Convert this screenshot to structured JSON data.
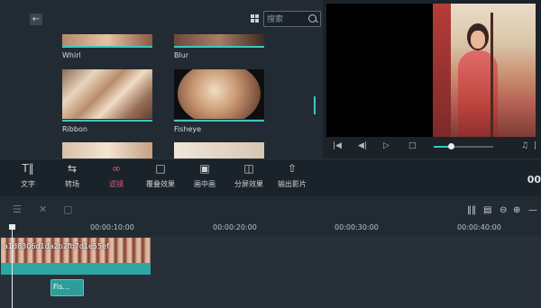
{
  "search": {
    "placeholder": "搜索"
  },
  "effects": {
    "items": [
      {
        "label": "Whirl"
      },
      {
        "label": "Blur"
      },
      {
        "label": "Ribbon"
      },
      {
        "label": "Fisheye"
      }
    ]
  },
  "toolbar": {
    "items": [
      {
        "label": "文字",
        "icon": "text-icon"
      },
      {
        "label": "转场",
        "icon": "transition-icon"
      },
      {
        "label": "滤镜",
        "icon": "filter-icon",
        "active": true
      },
      {
        "label": "覆叠效果",
        "icon": "overlay-icon"
      },
      {
        "label": "画中画",
        "icon": "pip-icon"
      },
      {
        "label": "分屏效果",
        "icon": "split-screen-icon"
      },
      {
        "label": "输出影片",
        "icon": "export-icon"
      }
    ],
    "timecode": "00"
  },
  "ruler": {
    "ticks": [
      "00:00:10:00",
      "00:00:20:00",
      "00:00:30:00",
      "00:00:40:00"
    ]
  },
  "clips": {
    "video_name": "a1d8306d1da2b2fb7d1e55ef",
    "title_clip": "Fis..."
  },
  "colors": {
    "accent": "#3cc7c1",
    "active": "#e9547a"
  }
}
